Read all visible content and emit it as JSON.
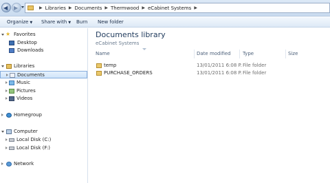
{
  "breadcrumb": [
    "Libraries",
    "Documents",
    "Thermwood",
    "eCabinet Systems"
  ],
  "toolbar": {
    "organize": "Organize",
    "share_with": "Share with",
    "burn": "Burn",
    "new_folder": "New folder"
  },
  "nav": {
    "favorites": "Favorites",
    "desktop": "Desktop",
    "downloads": "Downloads",
    "libraries": "Libraries",
    "documents": "Documents",
    "music": "Music",
    "pictures": "Pictures",
    "videos": "Videos",
    "homegroup": "Homegroup",
    "computer": "Computer",
    "local_c": "Local Disk (C:)",
    "local_f": "Local Disk (F:)",
    "network": "Network"
  },
  "main": {
    "title": "Documents library",
    "subtitle": "eCabinet Systems",
    "columns": {
      "name": "Name",
      "date_modified": "Date modified",
      "type": "Type",
      "size": "Size"
    },
    "files": [
      {
        "name": "temp",
        "date": "13/01/2011 6:08 P...",
        "type": "File folder"
      },
      {
        "name": "PURCHASE_ORDERS",
        "date": "13/01/2011 6:08 P...",
        "type": "File folder"
      }
    ]
  },
  "colors": {
    "selection_border": "#84acdd",
    "title_blue": "#1e395b",
    "folder_yellow": "#eac86b"
  }
}
